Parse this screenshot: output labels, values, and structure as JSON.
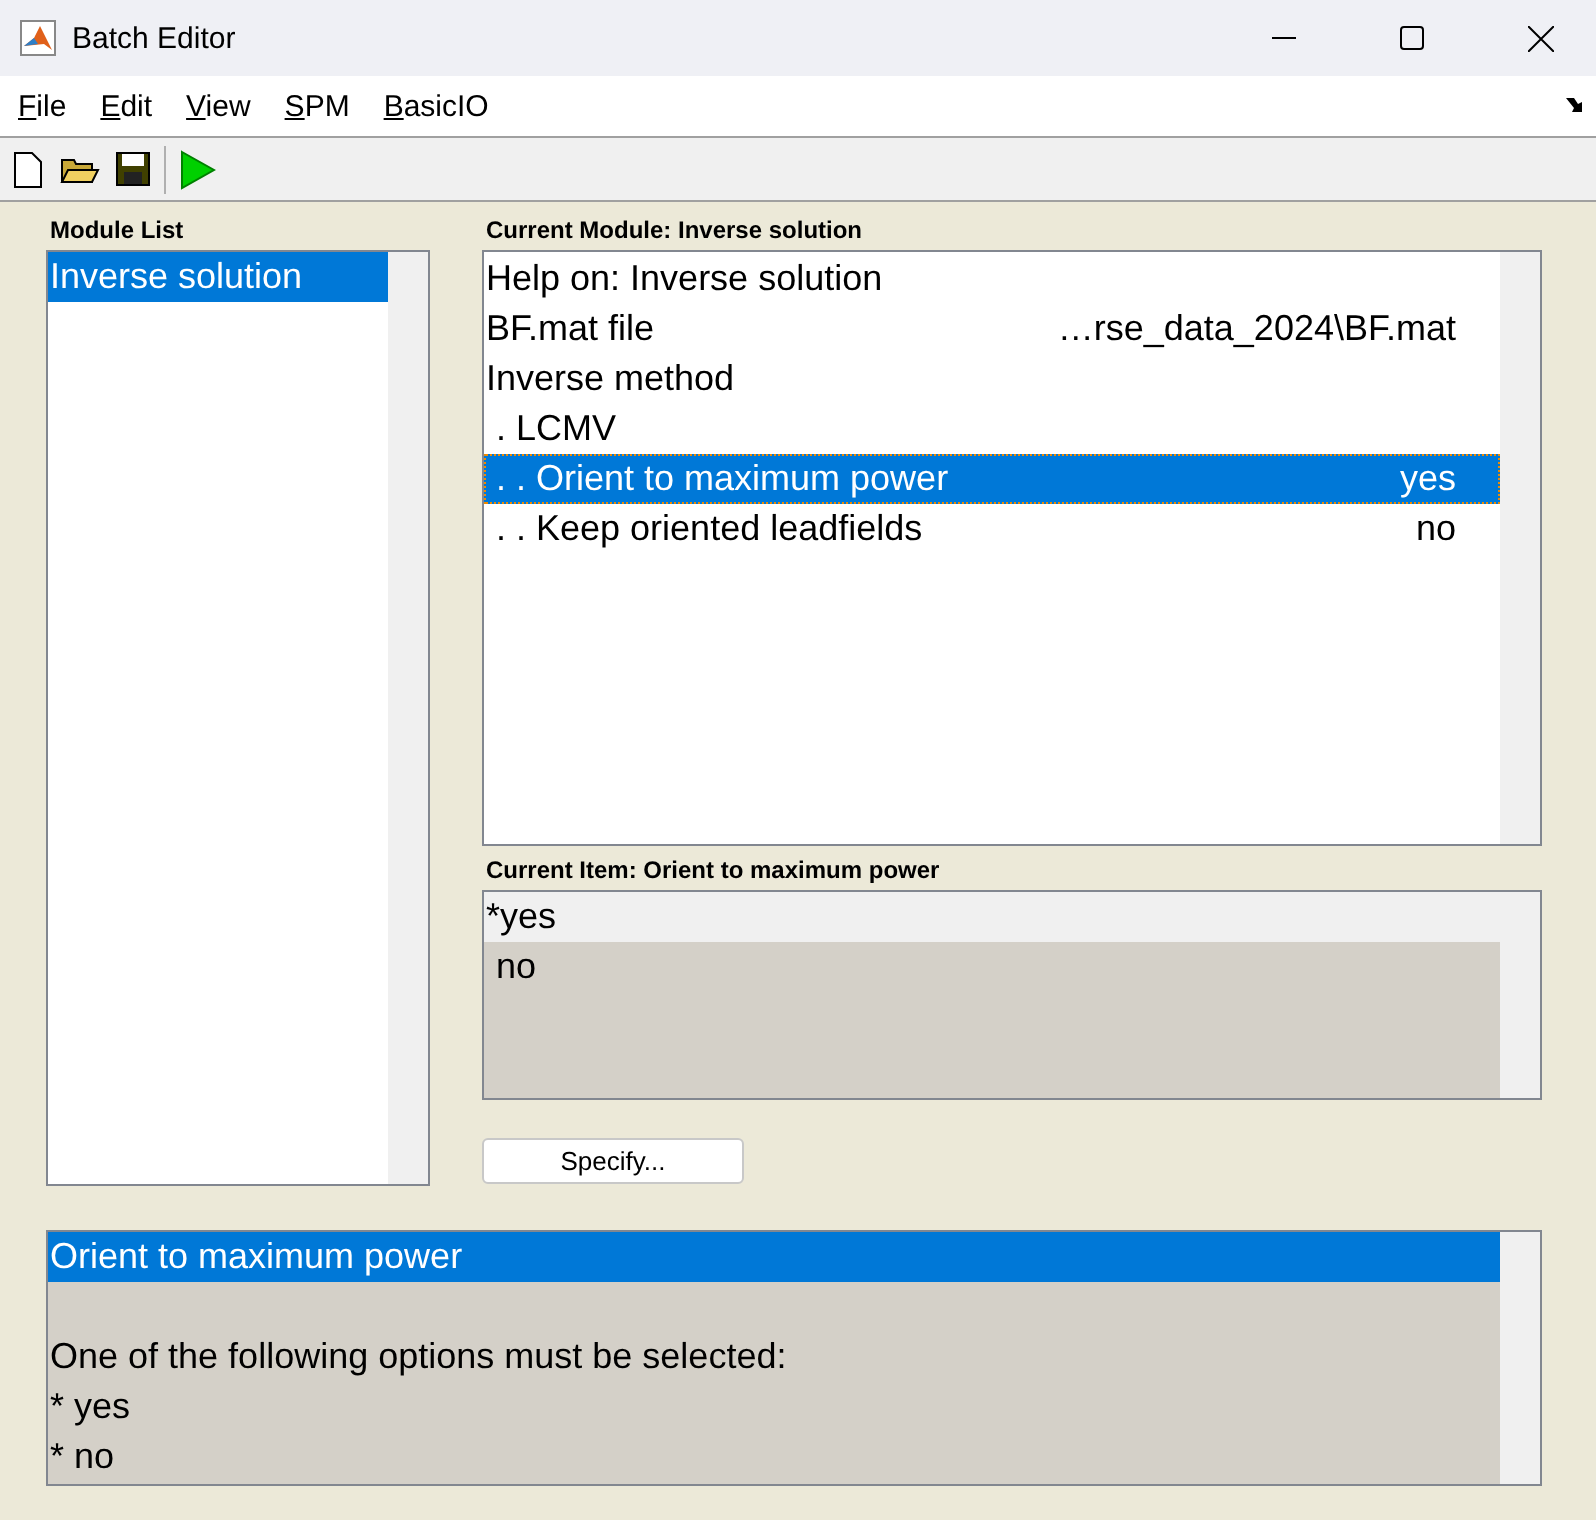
{
  "window": {
    "title": "Batch Editor"
  },
  "menu": [
    "File",
    "Edit",
    "View",
    "SPM",
    "BasicIO"
  ],
  "module_list": {
    "label": "Module List",
    "items": [
      {
        "label": "Inverse solution",
        "selected": true
      }
    ]
  },
  "current_module": {
    "label": "Current Module: Inverse solution",
    "rows": [
      {
        "label": "Help on: Inverse solution",
        "value": "",
        "selected": false
      },
      {
        "label": "BF.mat file",
        "value": "…rse_data_2024\\BF.mat",
        "selected": false
      },
      {
        "label": "Inverse method",
        "value": "",
        "selected": false
      },
      {
        "label": " . LCMV",
        "value": "",
        "selected": false
      },
      {
        "label": " . . Orient to maximum power",
        "value": "yes",
        "selected": true
      },
      {
        "label": " . . Keep oriented leadfields",
        "value": "no",
        "selected": false
      }
    ]
  },
  "current_item": {
    "label": "Current Item: Orient to maximum power",
    "options": [
      {
        "label": "*yes",
        "selected": true
      },
      {
        "label": " no",
        "selected": false
      }
    ]
  },
  "specify_button": "Specify...",
  "help": {
    "title": "Orient to maximum power",
    "lines": [
      "One of the following options must be selected:",
      "* yes",
      "* no"
    ]
  }
}
